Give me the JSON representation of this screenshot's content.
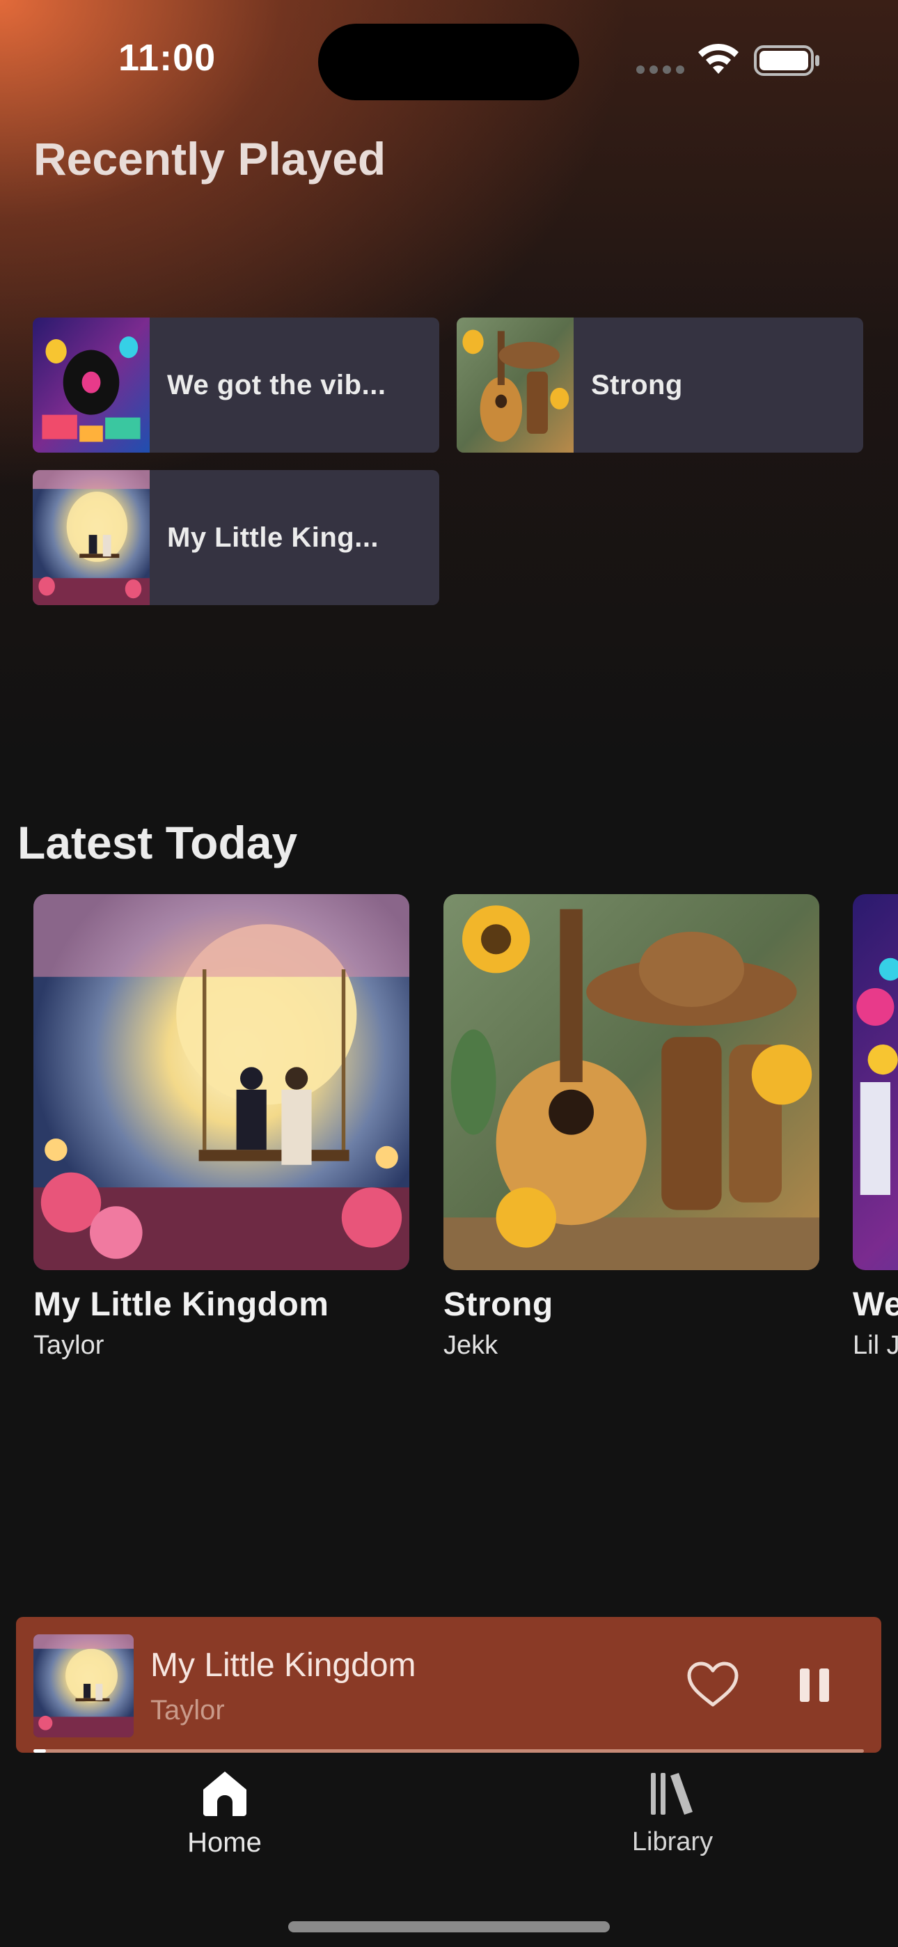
{
  "status_bar": {
    "time": "11:00"
  },
  "recently_played": {
    "title": "Recently Played",
    "items": [
      {
        "label": "We got the vib...",
        "art": "music-collage-art"
      },
      {
        "label": "Strong",
        "art": "country-guitar-art"
      },
      {
        "label": "My Little King...",
        "art": "moon-swing-art"
      }
    ]
  },
  "latest_today": {
    "title": "Latest Today",
    "items": [
      {
        "title": "My Little Kingdom",
        "artist": "Taylor",
        "art": "moon-swing-art"
      },
      {
        "title": "Strong",
        "artist": "Jekk",
        "art": "country-guitar-art"
      },
      {
        "title": "We",
        "artist": "Lil J",
        "art": "music-collage-art"
      }
    ]
  },
  "mini_player": {
    "title": "My Little Kingdom",
    "artist": "Taylor",
    "progress": 0.01,
    "liked": false,
    "state": "playing"
  },
  "nav": {
    "home_label": "Home",
    "library_label": "Library",
    "active": "home"
  },
  "colors": {
    "background": "#121212",
    "accent_gradient": "#eb6e3c",
    "card": "#353341",
    "mini_player": "#8a3a26"
  }
}
